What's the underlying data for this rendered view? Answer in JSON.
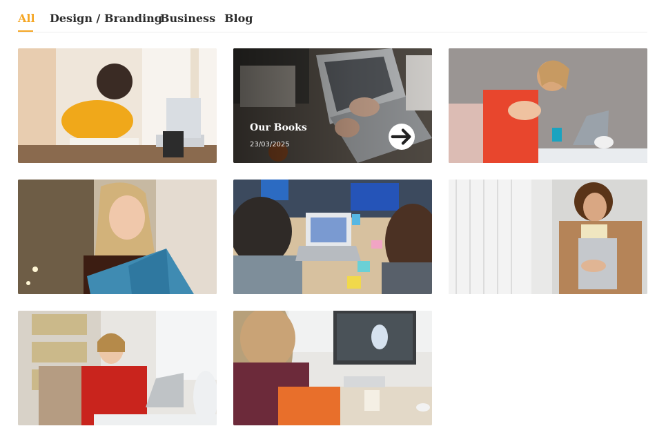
{
  "tabs": [
    {
      "label": "All",
      "active": true
    },
    {
      "label": "Design / Branding",
      "active": false
    },
    {
      "label": "Business",
      "active": false
    },
    {
      "label": "Blog",
      "active": false
    }
  ],
  "accent_color": "#f5a623",
  "featured_card": {
    "title": "Our Books",
    "date": "23/03/2025",
    "icon": "arrow-right-icon"
  },
  "cards": [
    {
      "photo": "woman writing at desk with laptop"
    },
    {
      "photo": "hands typing on laptop on desk"
    },
    {
      "photo": "stressed woman at laptop"
    },
    {
      "photo": "laughing woman holding book"
    },
    {
      "photo": "students with laptop and sticky notes"
    },
    {
      "photo": "woman holding laptop by window"
    },
    {
      "photo": "smiling woman at desk in office"
    },
    {
      "photo": "woman on video call at desktop computer"
    }
  ]
}
